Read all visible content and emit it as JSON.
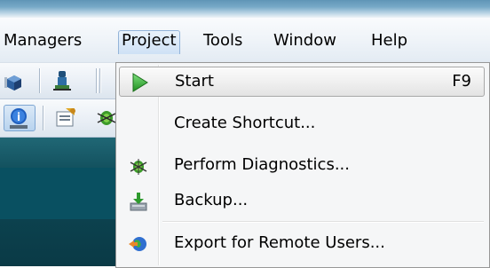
{
  "menubar": {
    "items": [
      {
        "label": "Managers"
      },
      {
        "label": "Project"
      },
      {
        "label": "Tools"
      },
      {
        "label": "Window"
      },
      {
        "label": "Help"
      }
    ]
  },
  "dropdown": {
    "items": [
      {
        "label": "Start",
        "shortcut": "F9",
        "icon": "play-icon"
      },
      {
        "label": "Create Shortcut...",
        "icon": ""
      },
      {
        "label": "Perform Diagnostics...",
        "icon": "diagnostics-bug-icon"
      },
      {
        "label": "Backup...",
        "icon": "backup-download-icon"
      },
      {
        "label": "Export for Remote Users...",
        "icon": "export-globe-icon"
      }
    ]
  },
  "toolbar": {
    "icons": [
      "database-icon",
      "user-icon",
      "info-icon",
      "properties-icon",
      "diagnostics-bug-icon"
    ]
  },
  "colors": {
    "start_icon": "#2fa52f",
    "dropdown_bg": "#f5f6f7",
    "background_dark": "#0a3a46"
  }
}
